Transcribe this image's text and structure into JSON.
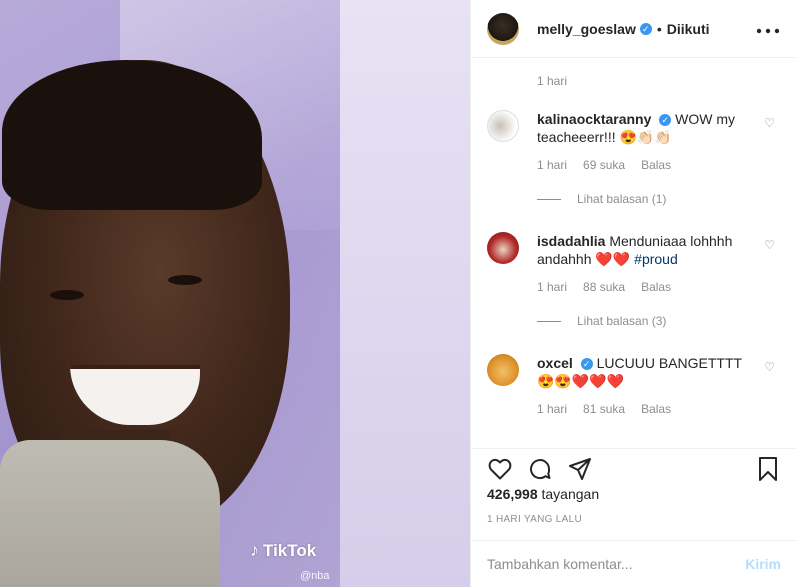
{
  "media": {
    "watermark_text": "TikTok",
    "watermark_handle": "@nba"
  },
  "header": {
    "username": "melly_goeslaw",
    "separator": "•",
    "follow_status": "Diikuti",
    "more_icon": "more-horizontal-icon"
  },
  "comments": {
    "top_meta": "1 hari",
    "items": [
      {
        "user": "kalinaocktaranny",
        "verified": true,
        "text": "WOW my teacheeerr!!! 😍👏🏻👏🏻",
        "time": "1 hari",
        "likes": "69 suka",
        "reply": "Balas",
        "view_replies": "Lihat balasan (1)"
      },
      {
        "user": "isdadahlia",
        "verified": false,
        "text": "Menduniaaa lohhhh andahhh ❤️❤️",
        "hashtag": "#proud",
        "time": "1 hari",
        "likes": "88 suka",
        "reply": "Balas",
        "view_replies": "Lihat balasan (3)"
      },
      {
        "user": "oxcel",
        "verified": true,
        "text": "LUCUUU BANGETTTT😍😍❤️❤️❤️",
        "time": "1 hari",
        "likes": "81 suka",
        "reply": "Balas"
      }
    ]
  },
  "actions": {
    "views_count": "426,998",
    "views_label": "tayangan",
    "time_ago": "1 HARI YANG LALU"
  },
  "add_comment": {
    "placeholder": "Tambahkan komentar...",
    "send_label": "Kirim"
  },
  "colors": {
    "verified_blue": "#3897f0",
    "send_disabled": "#b2dffc",
    "meta_gray": "#8e8e8e"
  }
}
